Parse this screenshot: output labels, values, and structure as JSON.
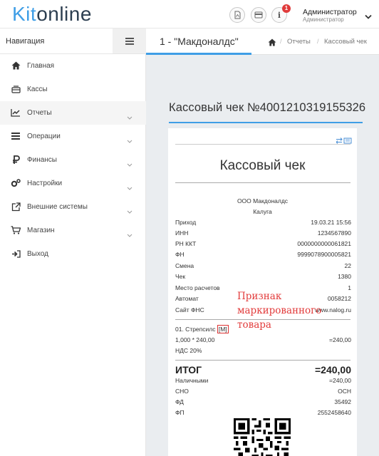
{
  "app": {
    "logo_part1": "Kit",
    "logo_part2": "online",
    "notification_count": "1",
    "user_name": "Администратор",
    "user_role": "Администратор"
  },
  "sidebar": {
    "title": "Навигация",
    "items": [
      {
        "label": "Главная",
        "icon": "home-icon",
        "has_chevron": false
      },
      {
        "label": "Кассы",
        "icon": "cash-register-icon",
        "has_chevron": false
      },
      {
        "label": "Отчеты",
        "icon": "chart-icon",
        "has_chevron": true
      },
      {
        "label": "Операции",
        "icon": "list-icon",
        "has_chevron": true
      },
      {
        "label": "Финансы",
        "icon": "ruble-icon",
        "has_chevron": true
      },
      {
        "label": "Настройки",
        "icon": "gears-icon",
        "has_chevron": true
      },
      {
        "label": "Внешние системы",
        "icon": "external-link-icon",
        "has_chevron": true
      },
      {
        "label": "Магазин",
        "icon": "cart-icon",
        "has_chevron": true
      },
      {
        "label": "Выход",
        "icon": "logout-icon",
        "has_chevron": false
      }
    ]
  },
  "header": {
    "tab_title": "1 - \"Макдоналдс\"",
    "breadcrumb": [
      "Отчеты",
      "Кассовый чек"
    ]
  },
  "page": {
    "title": "Кассовый чек №4001210319155326"
  },
  "receipt": {
    "heading": "Кассовый чек",
    "org_name": "ООО Макдоналдс",
    "org_city": "Калуга",
    "rows": [
      {
        "key": "Приход",
        "value": "19.03.21 15:56"
      },
      {
        "key": "ИНН",
        "value": "1234567890"
      },
      {
        "key": "РН ККТ",
        "value": "0000000000061821"
      },
      {
        "key": "ФН",
        "value": "9999078900005821"
      },
      {
        "key": "Смена",
        "value": "22"
      },
      {
        "key": "Чек",
        "value": "1380"
      },
      {
        "key": "Место расчетов",
        "value": "1"
      },
      {
        "key": "Автомат",
        "value": "0058212"
      },
      {
        "key": "Сайт ФНС",
        "value": "www.nalog.ru"
      }
    ],
    "item_name": "01. Стрепсилс",
    "item_mark": "[M]",
    "item_calc": "1,000 * 240,00",
    "item_sum": "=240,00",
    "item_vat": "НДС 20%",
    "total_label": "ИТОГ",
    "total_value": "=240,00",
    "footer_rows": [
      {
        "key": "Наличными",
        "value": "=240,00"
      },
      {
        "key": "СНО",
        "value": "ОСН"
      },
      {
        "key": "ФД",
        "value": "35492"
      },
      {
        "key": "ФП",
        "value": "2552458640"
      }
    ]
  },
  "annotation": {
    "text": "Признак\nмаркированного\nтовара"
  },
  "colors": {
    "accent": "#3f9ee6",
    "annotation": "#e23b3b",
    "badge": "#e03b3b"
  }
}
